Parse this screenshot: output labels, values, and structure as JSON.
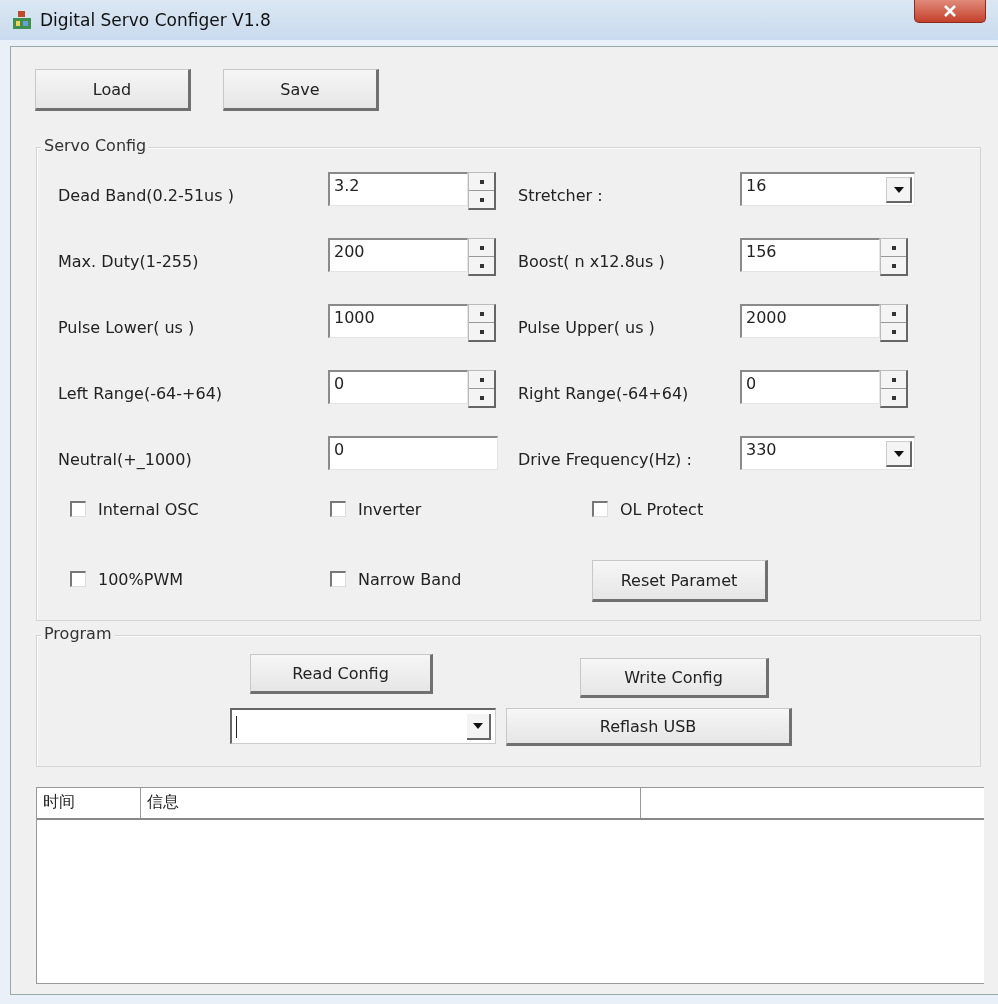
{
  "window": {
    "title": "Digital Servo Configer V1.8"
  },
  "toolbar": [
    {
      "label": "Load"
    },
    {
      "label": "Save"
    }
  ],
  "servo_config": {
    "title": "Servo Config",
    "fields": [
      {
        "label": "Dead Band(0.2-51us )",
        "value": "3.2",
        "kind": "spin"
      },
      {
        "label": "Stretcher :",
        "value": "16",
        "kind": "dropdown"
      },
      {
        "label": "Max. Duty(1-255)",
        "value": "200",
        "kind": "spin"
      },
      {
        "label": "Boost( n x12.8us )",
        "value": "156",
        "kind": "spin"
      },
      {
        "label": "Pulse Lower( us )",
        "value": "1000",
        "kind": "spin"
      },
      {
        "label": "Pulse Upper( us )",
        "value": "2000",
        "kind": "spin"
      },
      {
        "label": "Left Range(-64-+64)",
        "value": "0",
        "kind": "spin"
      },
      {
        "label": "Right Range(-64+64)",
        "value": "0",
        "kind": "spin"
      },
      {
        "label": "Neutral(+_1000)",
        "value": "0",
        "kind": "text"
      },
      {
        "label": "Drive Frequency(Hz) :",
        "value": "330",
        "kind": "dropdown"
      }
    ],
    "checkboxes": [
      {
        "label": "Internal OSC",
        "checked": false
      },
      {
        "label": "Inverter",
        "checked": false
      },
      {
        "label": "OL Protect",
        "checked": false
      },
      {
        "label": "100%PWM",
        "checked": false
      },
      {
        "label": "Narrow Band",
        "checked": false
      }
    ],
    "reset_button": "Reset Paramet"
  },
  "program": {
    "title": "Program",
    "read_button": "Read Config",
    "write_button": "Write Config",
    "reflash_button": "Reflash USB"
  },
  "log_table": {
    "columns": [
      "时间",
      "信息"
    ]
  }
}
